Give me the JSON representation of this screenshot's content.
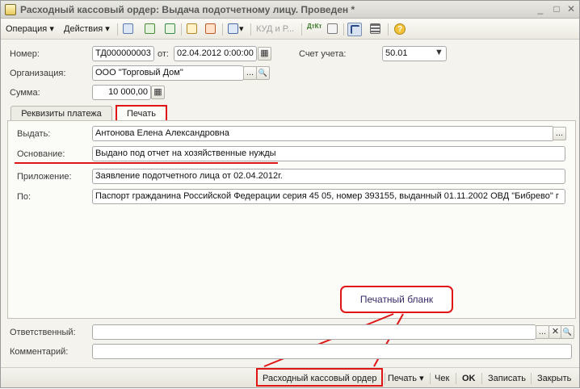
{
  "window": {
    "title": "Расходный кассовый ордер: Выдача подотчетному лицу. Проведен *",
    "controls": {
      "minimize": "_",
      "maximize": "□",
      "close": "✕"
    }
  },
  "toolbar": {
    "operation": "Операция",
    "actions": "Действия",
    "kud": "КУД и Р...",
    "dt_kt": "ДтКт",
    "help": "?",
    "dropdown_arrow": "▾"
  },
  "header": {
    "number_label": "Номер:",
    "number_value": "ТД000000003",
    "from_label": "от:",
    "date_value": "02.04.2012  0:00:00",
    "account_label": "Счет учета:",
    "account_value": "50.01",
    "org_label": "Организация:",
    "org_value": "ООО \"Торговый Дом\"",
    "sum_label": "Сумма:",
    "sum_value": "10 000,00"
  },
  "tabs": [
    {
      "label": "Реквизиты платежа"
    },
    {
      "label": "Печать"
    }
  ],
  "print_tab": {
    "issue_label": "Выдать:",
    "issue_value": "Антонова Елена Александровна",
    "basis_label": "Основание:",
    "basis_value": "Выдано под отчет на хозяйственные нужды",
    "attachment_label": "Приложение:",
    "attachment_value": "Заявление подотчетного лица от 02.04.2012г.",
    "by_label": "По:",
    "by_value": "Паспорт гражданина Российской Федерации серия 45 05, номер 393155, выданный 01.11.2002 ОВД \"Бибрево\" г"
  },
  "callout": {
    "text": "Печатный бланк"
  },
  "footer": {
    "responsible_label": "Ответственный:",
    "responsible_value": "",
    "comment_label": "Комментарий:",
    "comment_value": ""
  },
  "bottom": {
    "print_form": "Расходный кассовый ордер",
    "print": "Печать",
    "check": "Чек",
    "ok": "OK",
    "save": "Записать",
    "close": "Закрыть"
  },
  "colors": {
    "highlight": "#e01515",
    "callout_text": "#3a2a6a"
  },
  "icons": {
    "select": "...",
    "search": "🔍",
    "clear": "✕",
    "calculator": "▦",
    "dropdown": "▼"
  }
}
